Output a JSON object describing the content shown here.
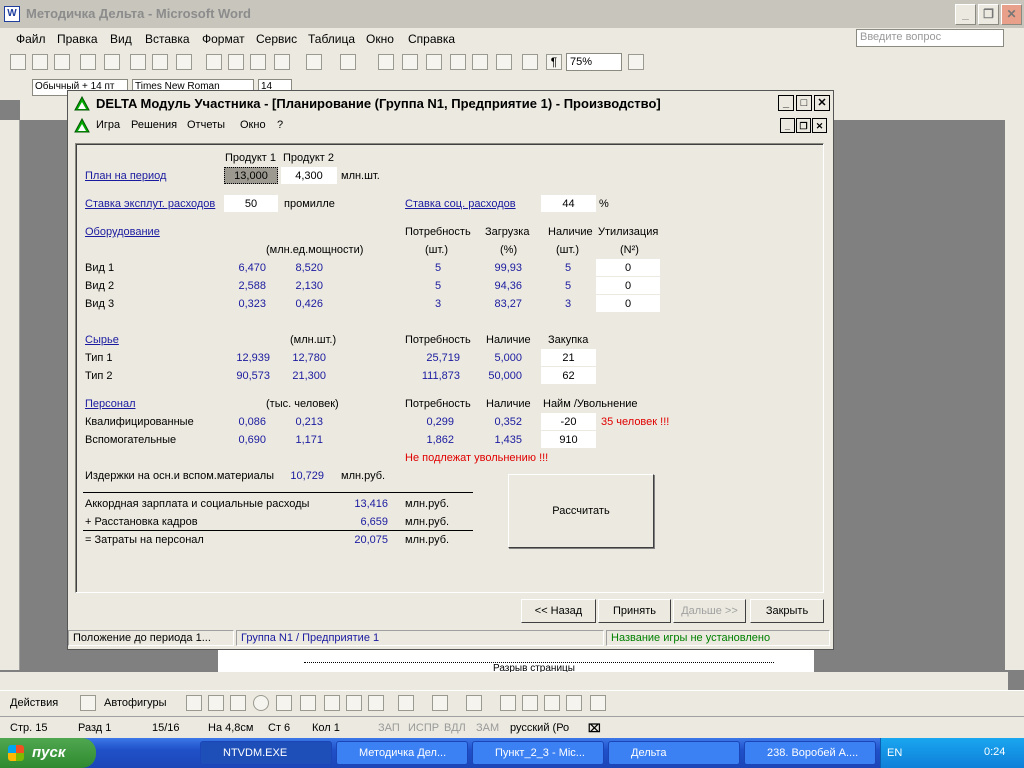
{
  "word": {
    "title": "Методичка Дельта - Microsoft Word",
    "menu": [
      "Файл",
      "Правка",
      "Вид",
      "Вставка",
      "Формат",
      "Сервис",
      "Таблица",
      "Окно",
      "Справка"
    ],
    "help_placeholder": "Введите вопрос",
    "zoom": "75%",
    "style_box": "Обычный + 14 пт",
    "font_box": "Times New Roman",
    "size_box": "14",
    "page_break": "Разрыв страницы",
    "draw_actions": "Действия",
    "draw_autoshapes": "Автофигуры",
    "status": {
      "page": "Стр. 15",
      "section": "Разд 1",
      "pages": "15/16",
      "at": "На 4,8см",
      "line": "Ст 6",
      "col": "Кол 1",
      "rec": "ЗАП",
      "trk": "ИСПР",
      "ext": "ВДЛ",
      "ovr": "ЗАМ",
      "lang": "русский (Ро"
    }
  },
  "taskbar": {
    "start": "пуск",
    "tasks": [
      "NTVDM.EXE",
      "Методичка Дел...",
      "Пункт_2_3 - Mic...",
      "Дельта",
      "238. Воробей А...."
    ],
    "lang": "EN",
    "time": "0:24"
  },
  "delta": {
    "title": "DELTA Модуль Участника - [Планирование (Группа N1, Предприятие 1) - Производство]",
    "menu": [
      "Игра",
      "Решения",
      "Отчеты",
      "Окно",
      "?"
    ],
    "product_headers": [
      "Продукт 1",
      "Продукт 2"
    ],
    "plan": {
      "label": "План на период",
      "p1": "13,000",
      "p2": "4,300",
      "unit": "млн.шт."
    },
    "expl_rate": {
      "label": "Ставка эксплут. расходов",
      "value": "50",
      "unit": "промилле"
    },
    "social_rate": {
      "label": "Ставка соц. расходов",
      "value": "44",
      "unit": "%"
    },
    "equipment": {
      "label": "Оборудование",
      "unit": "(млн.ед.мощности)",
      "headers": [
        "Потребность",
        "Загрузка",
        "Наличие",
        "Утилизация"
      ],
      "subheaders": [
        "(шт.)",
        "(%)",
        "(шт.)",
        "(N²)"
      ],
      "rows": [
        {
          "name": "Вид 1",
          "p1": "6,470",
          "p2": "8,520",
          "need": "5",
          "load": "99,93",
          "have": "5",
          "util": "0"
        },
        {
          "name": "Вид 2",
          "p1": "2,588",
          "p2": "2,130",
          "need": "5",
          "load": "94,36",
          "have": "5",
          "util": "0"
        },
        {
          "name": "Вид 3",
          "p1": "0,323",
          "p2": "0,426",
          "need": "3",
          "load": "83,27",
          "have": "3",
          "util": "0"
        }
      ]
    },
    "raw": {
      "label": "Сырье",
      "unit": "(млн.шт.)",
      "headers": [
        "Потребность",
        "Наличие",
        "Закупка"
      ],
      "rows": [
        {
          "name": "Тип 1",
          "p1": "12,939",
          "p2": "12,780",
          "need": "25,719",
          "have": "5,000",
          "buy": "21"
        },
        {
          "name": "Тип 2",
          "p1": "90,573",
          "p2": "21,300",
          "need": "111,873",
          "have": "50,000",
          "buy": "62"
        }
      ]
    },
    "staff": {
      "label": "Персонал",
      "unit": "(тыс. человек)",
      "headers": [
        "Потребность",
        "Наличие",
        "Найм /Увольнение"
      ],
      "rows": [
        {
          "name": "Квалифицированные",
          "p1": "0,086",
          "p2": "0,213",
          "need": "0,299",
          "have": "0,352",
          "hire": "-20",
          "note": "35 человек !!!"
        },
        {
          "name": "Вспомогательные",
          "p1": "0,690",
          "p2": "1,171",
          "need": "1,862",
          "have": "1,435",
          "hire": "910",
          "note": ""
        }
      ],
      "warning": "Не подлежат увольнению !!!"
    },
    "materials": {
      "label": "Издержки на осн.и вспом.материалы",
      "value": "10,729",
      "unit": "млн.руб."
    },
    "costs": [
      {
        "label": "Аккордная зарплата и социальные расходы",
        "value": "13,416",
        "unit": "млн.руб."
      },
      {
        "label": "+ Расстановка кадров",
        "value": "6,659",
        "unit": "млн.руб."
      },
      {
        "label": "= Затраты на персонал",
        "value": "20,075",
        "unit": "млн.руб."
      }
    ],
    "calc_button": "Рассчитать",
    "nav": {
      "back": "<< Назад",
      "accept": "Принять",
      "next": "Дальше >>",
      "close": "Закрыть"
    },
    "status": {
      "left": "Положение до периода 1...",
      "mid": "Группа N1 / Предприятие 1",
      "right": "Название игры не установлено"
    }
  },
  "colors": {
    "link": "#1a1aa0",
    "warning": "#e00000",
    "status_green": "#008000",
    "taskbar": "#2453c8"
  }
}
